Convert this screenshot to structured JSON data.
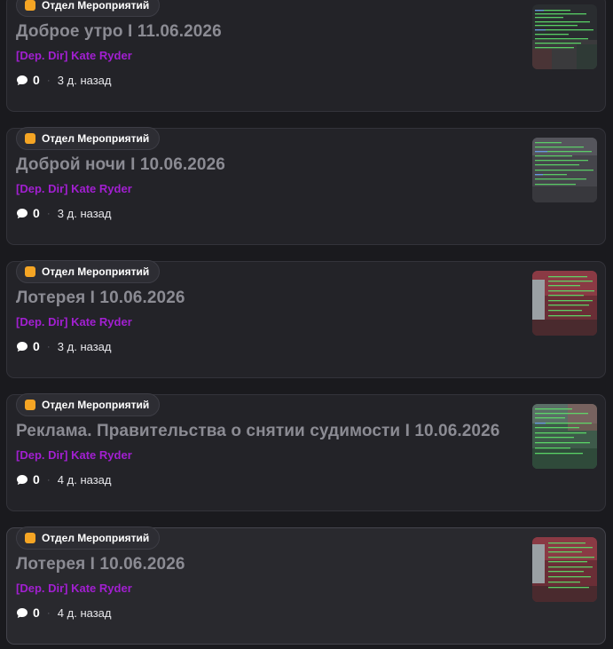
{
  "posts": [
    {
      "category": "Отдел Мероприятий",
      "title": "Доброе утро I 11.06.2026",
      "author": "[Dep. Dir] Kate Ryder",
      "comments": "0",
      "time_ago": "3 д. назад",
      "thumbnail": "screenshot-dark-street-thumbnail"
    },
    {
      "category": "Отдел Мероприятий",
      "title": "Доброй ночи I 10.06.2026",
      "author": "[Dep. Dir] Kate Ryder",
      "comments": "0",
      "time_ago": "3 д. назад",
      "thumbnail": "screenshot-gray-room-thumbnail"
    },
    {
      "category": "Отдел Мероприятий",
      "title": "Лотерея I 10.06.2026",
      "author": "[Dep. Dir] Kate Ryder",
      "comments": "0",
      "time_ago": "3 д. назад",
      "thumbnail": "screenshot-red-building-thumbnail"
    },
    {
      "category": "Отдел Мероприятий",
      "title": "Реклама. Правительства о снятии судимости I 10.06.2026",
      "author": "[Dep. Dir] Kate Ryder",
      "comments": "0",
      "time_ago": "4 д. назад",
      "thumbnail": "screenshot-green-park-thumbnail"
    },
    {
      "category": "Отдел Мероприятий",
      "title": "Лотерея I 10.06.2026",
      "author": "[Dep. Dir] Kate Ryder",
      "comments": "0",
      "time_ago": "4 д. назад",
      "thumbnail": "screenshot-red-building-thumbnail"
    }
  ],
  "colors": {
    "tag_icon": "#f5a524",
    "author": "#a21fd1",
    "title": "#8b8b93",
    "card_bg": "#232328",
    "page_bg": "#1a1a1e"
  }
}
